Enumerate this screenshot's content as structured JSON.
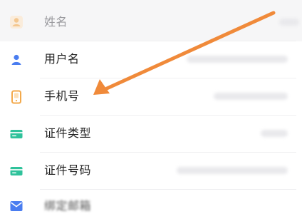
{
  "rows": [
    {
      "label": "姓名",
      "icon": "person-icon",
      "icon_color": "#f3a94b"
    },
    {
      "label": "用户名",
      "icon": "person-icon",
      "icon_color": "#4a7df0"
    },
    {
      "label": "手机号",
      "icon": "phone-icon",
      "icon_color": "#f3a94b"
    },
    {
      "label": "证件类型",
      "icon": "id-card-icon",
      "icon_color": "#2fc29b"
    },
    {
      "label": "证件号码",
      "icon": "id-card-icon",
      "icon_color": "#2fc29b"
    },
    {
      "label": "绑定邮箱",
      "icon": "mail-icon",
      "icon_color": "#4a7df0"
    }
  ],
  "annotation": {
    "arrow_color": "#f08a3a"
  }
}
